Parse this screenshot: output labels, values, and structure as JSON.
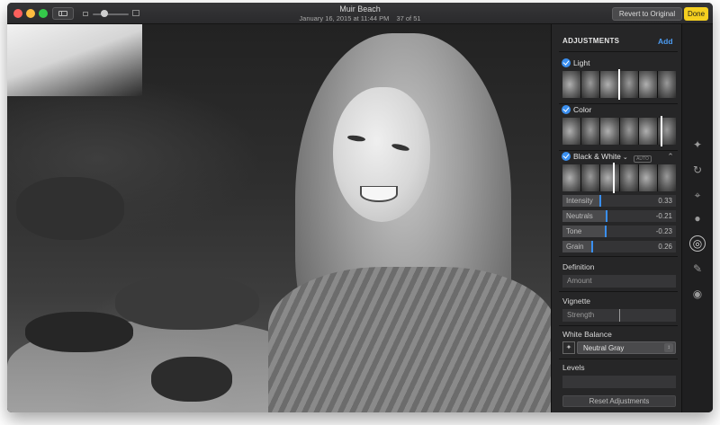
{
  "window": {
    "title": "Muir Beach",
    "date": "January 16, 2015 at 11:44 PM",
    "counter": "37 of 51",
    "revert_label": "Revert to Original",
    "done_label": "Done"
  },
  "zoom": {
    "level": 0.25
  },
  "panel": {
    "heading": "ADJUSTMENTS",
    "add_label": "Add",
    "sections": {
      "light": {
        "label": "Light",
        "enabled": true,
        "marker": 0.5
      },
      "color": {
        "label": "Color",
        "enabled": true,
        "marker": 0.88
      },
      "bw": {
        "label": "Black & White",
        "enabled": true,
        "auto_label": "AUTO",
        "marker": 0.45,
        "sliders": [
          {
            "label": "Intensity",
            "value": "0.33",
            "position": 0.33
          },
          {
            "label": "Neutrals",
            "value": "-0.21",
            "position": 0.39
          },
          {
            "label": "Tone",
            "value": "-0.23",
            "position": 0.38
          },
          {
            "label": "Grain",
            "value": "0.26",
            "position": 0.26
          }
        ]
      }
    },
    "definition": {
      "title": "Definition",
      "field_label": "Amount"
    },
    "vignette": {
      "title": "Vignette",
      "field_label": "Strength",
      "position": 0.5
    },
    "white_balance": {
      "title": "White Balance",
      "value": "Neutral Gray"
    },
    "levels": {
      "title": "Levels"
    },
    "reset_label": "Reset Adjustments"
  },
  "toolbar": {
    "tools": [
      "magic-wand-icon",
      "rotate-icon",
      "crop-icon",
      "filters-icon",
      "adjust-icon",
      "retouch-icon",
      "red-eye-icon"
    ]
  },
  "colors": {
    "accent": "#3a8ff0",
    "done": "#f5cf1f",
    "add_link": "#4c9cf2"
  }
}
